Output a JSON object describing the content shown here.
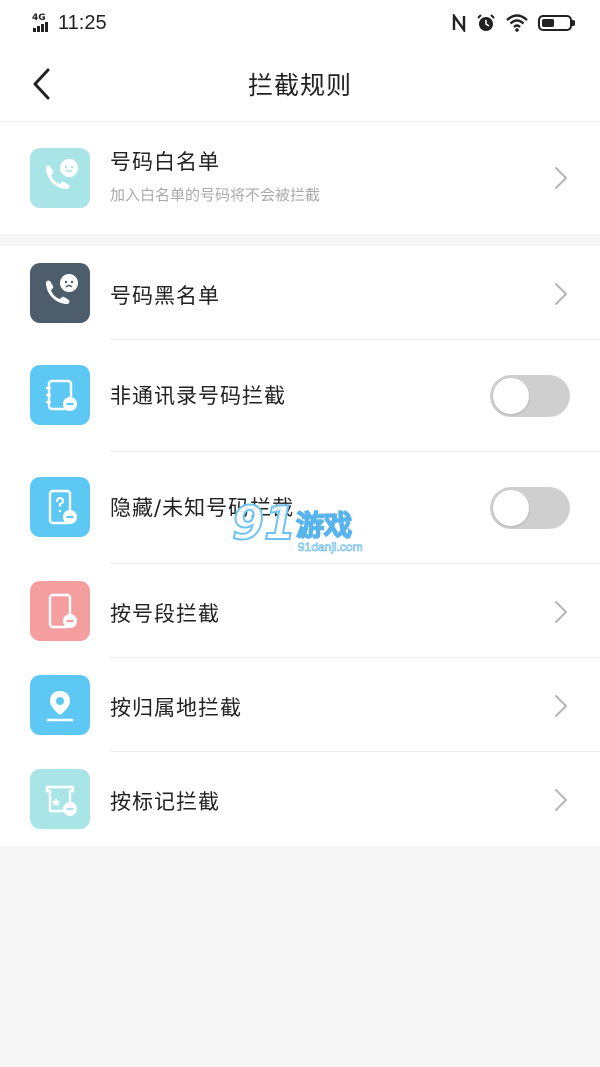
{
  "status_bar": {
    "network": "4G",
    "time": "11:25",
    "nfc_icon": "nfc-icon",
    "alarm_icon": "alarm-icon",
    "wifi_icon": "wifi-icon",
    "battery_icon": "battery-icon"
  },
  "header": {
    "title": "拦截规则",
    "back_icon": "chevron-left-icon"
  },
  "colors": {
    "whitelist_icon_bg": "#a9e4e6",
    "blacklist_icon_bg": "#4e5d6b",
    "contacts_icon_bg": "#5cc8f3",
    "hidden_icon_bg": "#5cc8f3",
    "segment_icon_bg": "#f49ea0",
    "location_icon_bg": "#5cc8f3",
    "tag_icon_bg": "#a9e4e6",
    "toggle_off": "#cfcfcf"
  },
  "whitelist": {
    "title": "号码白名单",
    "subtitle": "加入白名单的号码将不会被拦截",
    "icon": "phone-smile-icon"
  },
  "rules": [
    {
      "title": "号码黑名单",
      "icon": "phone-sad-icon",
      "control": "chevron"
    },
    {
      "title": "非通讯录号码拦截",
      "icon": "contacts-block-icon",
      "control": "toggle",
      "enabled": false
    },
    {
      "title": "隐藏/未知号码拦截",
      "icon": "unknown-phone-icon",
      "control": "toggle",
      "enabled": false
    },
    {
      "title": "按号段拦截",
      "icon": "phone-block-icon",
      "control": "chevron"
    },
    {
      "title": "按归属地拦截",
      "icon": "location-pin-icon",
      "control": "chevron"
    },
    {
      "title": "按标记拦截",
      "icon": "tag-block-icon",
      "control": "chevron"
    }
  ],
  "watermark": {
    "number": "91",
    "name": "游戏",
    "url": "91danji.com"
  }
}
